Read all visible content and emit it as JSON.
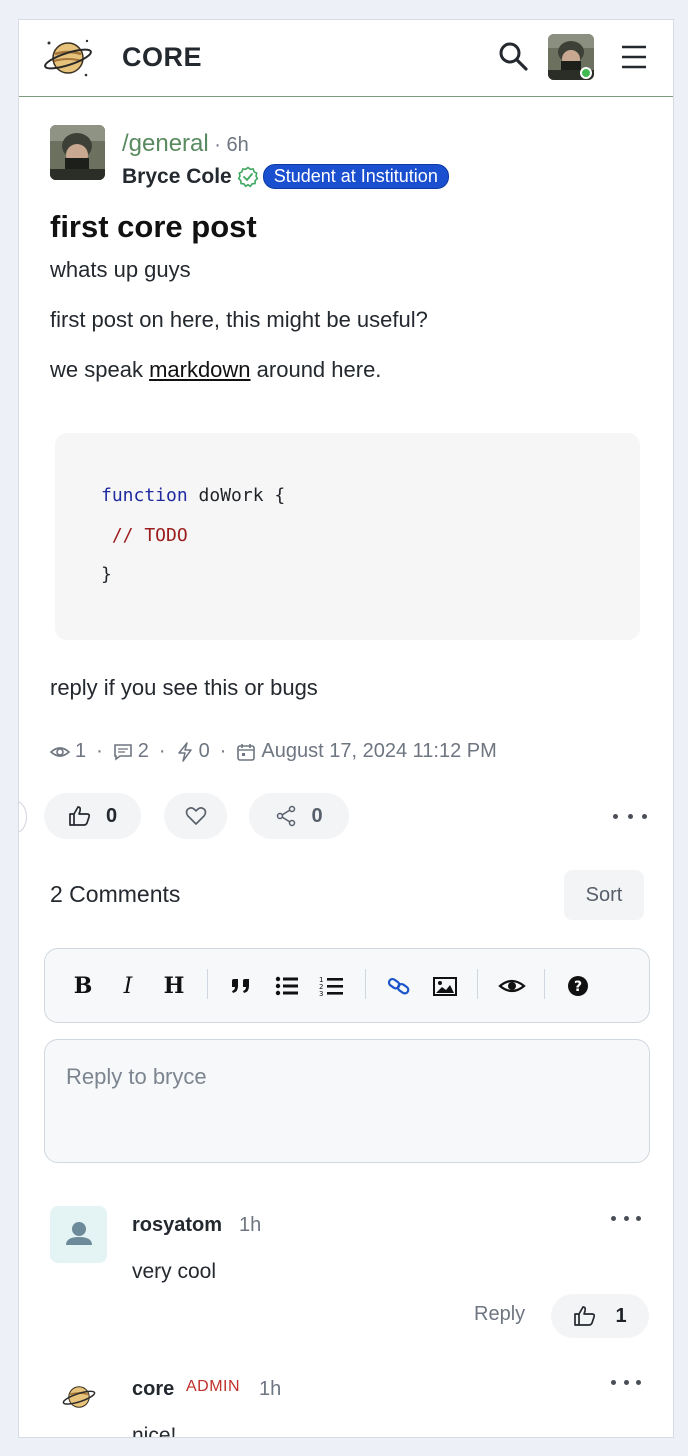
{
  "header": {
    "brand": "CORE"
  },
  "post": {
    "community": "/general",
    "age": "6h",
    "author": "Bryce Cole",
    "role_badge": "Student at Institution",
    "title": "first core post",
    "body": {
      "line1": "whats up guys",
      "line2": "first post on here, this might be useful?",
      "line3_before": "we speak ",
      "line3_link": "markdown",
      "line3_after": " around here.",
      "code": {
        "keyword": "function",
        "name": " doWork {",
        "comment": " // TODO",
        "close": "}"
      },
      "line4": "reply if you see this or bugs"
    },
    "stats": {
      "views": "1",
      "comments": "2",
      "boosts": "0",
      "date": "August 17, 2024 11:12 PM"
    },
    "actions": {
      "likes": "0",
      "shares": "0"
    }
  },
  "comments_section": {
    "title": "2 Comments",
    "sort_label": "Sort",
    "reply_placeholder": "Reply to bryce",
    "toolbar": {
      "bold": "B",
      "italic": "I",
      "heading": "H"
    },
    "items": [
      {
        "user": "rosyatom",
        "age": "1h",
        "body": "very cool",
        "reply_label": "Reply",
        "likes": "1"
      },
      {
        "user": "core",
        "tag": "ADMIN",
        "age": "1h",
        "body": "nice!"
      }
    ]
  },
  "colors": {
    "accent_green": "#5a8a5f",
    "badge_blue": "#1a4fd0",
    "admin_red": "#c0302a"
  }
}
